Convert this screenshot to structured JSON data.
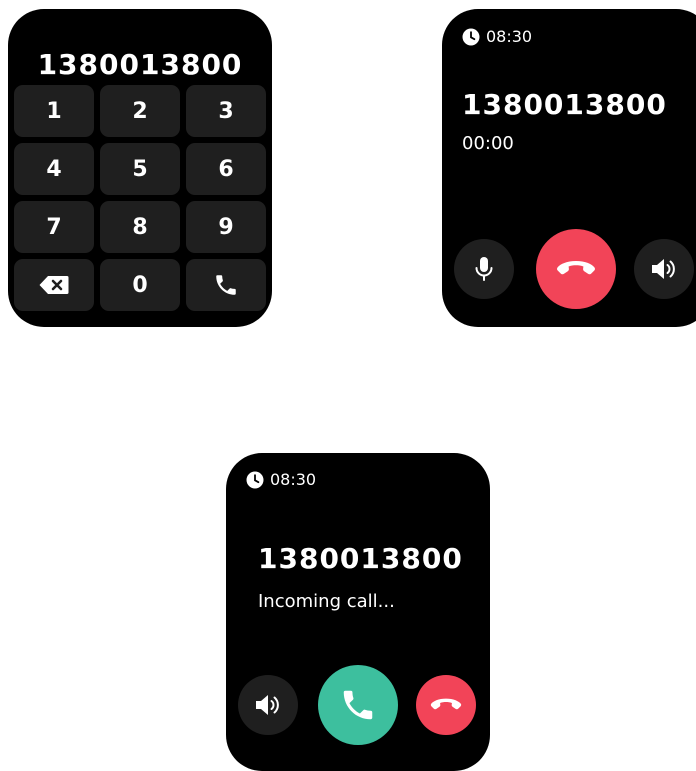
{
  "dialer": {
    "number": "1380013800",
    "keys": [
      "1",
      "2",
      "3",
      "4",
      "5",
      "6",
      "7",
      "8",
      "9",
      "0"
    ],
    "icons": {
      "delete": "backspace-icon",
      "call": "phone-icon"
    }
  },
  "active_call": {
    "time": "08:30",
    "number": "1380013800",
    "duration": "00:00",
    "icons": {
      "clock": "clock-icon",
      "mute": "microphone-icon",
      "end": "hang-up-icon",
      "speaker": "speaker-icon"
    }
  },
  "incoming_call": {
    "time": "08:30",
    "number": "1380013800",
    "status": "Incoming call...",
    "icons": {
      "clock": "clock-icon",
      "speaker": "speaker-icon",
      "answer": "phone-icon",
      "decline": "hang-up-icon"
    }
  },
  "colors": {
    "screen_background": "#000000",
    "key_background": "#1f1f1f",
    "answer_green": "#3dbf9e",
    "end_red": "#f24458",
    "text": "#ffffff"
  }
}
